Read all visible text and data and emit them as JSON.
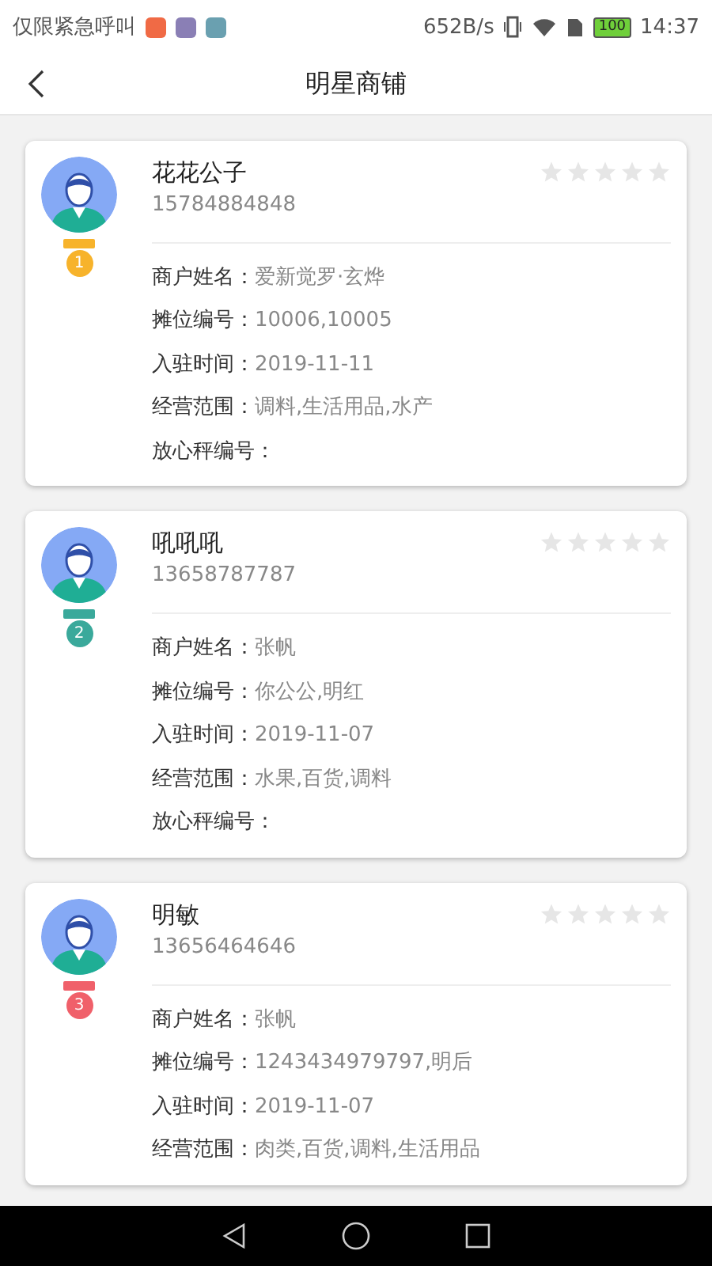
{
  "status_bar": {
    "carrier": "仅限紧急呼叫",
    "speed": "652B/s",
    "battery": "100",
    "time": "14:37"
  },
  "header": {
    "title": "明星商铺"
  },
  "shops": [
    {
      "name": "花花公子",
      "phone": "15784884848",
      "rank": "1",
      "color": "#f7b32b",
      "stars": 0,
      "fields": [
        {
          "label": "商户姓名：",
          "value": "爱新觉罗·玄烨"
        },
        {
          "label": "摊位编号：",
          "value": "10006,10005"
        },
        {
          "label": "入驻时间：",
          "value": "2019-11-11"
        },
        {
          "label": "经营范围：",
          "value": "调料,生活用品,水产"
        },
        {
          "label": "放心秤编号："
        }
      ]
    },
    {
      "name": "吼吼吼",
      "phone": "13658787787",
      "rank": "2",
      "color": "#3aa99b",
      "stars": 0,
      "fields": [
        {
          "label": "商户姓名：",
          "value": "张帆"
        },
        {
          "label": "摊位编号：",
          "value": "你公公,明红"
        },
        {
          "label": "入驻时间：",
          "value": "2019-11-07"
        },
        {
          "label": "经营范围：",
          "value": "水果,百货,调料"
        },
        {
          "label": "放心秤编号："
        }
      ]
    },
    {
      "name": "明敏",
      "phone": "13656464646",
      "rank": "3",
      "color": "#f0606a",
      "stars": 0,
      "fields": [
        {
          "label": "商户姓名：",
          "value": "张帆"
        },
        {
          "label": "摊位编号：",
          "value": "1243434979797,明后"
        },
        {
          "label": "入驻时间：",
          "value": "2019-11-07"
        },
        {
          "label": "经营范围：",
          "value": "肉类,百货,调料,生活用品"
        }
      ]
    }
  ]
}
